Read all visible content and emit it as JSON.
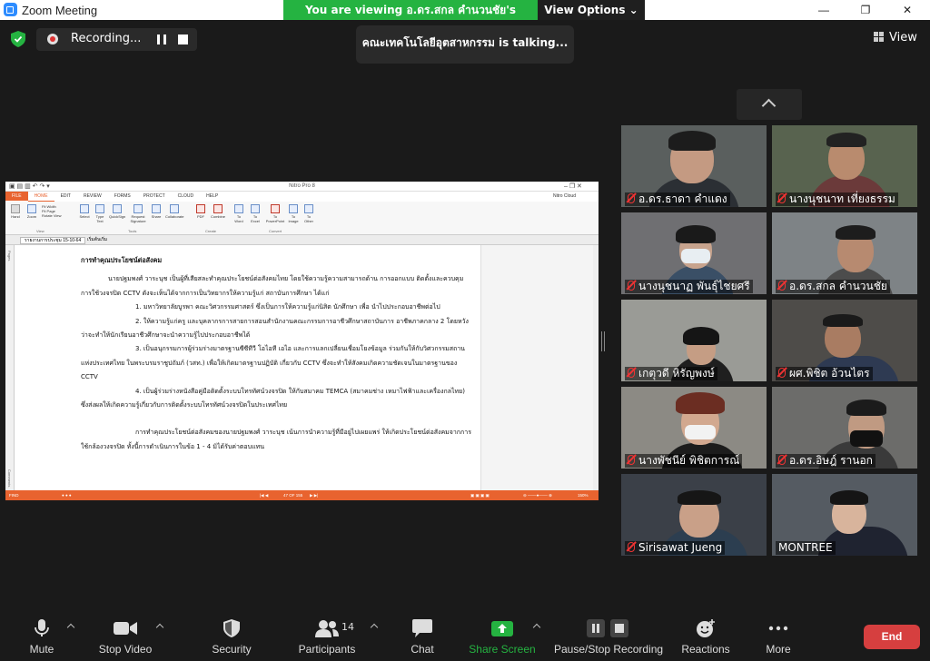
{
  "window": {
    "title": "Zoom Meeting",
    "minimize": "—",
    "maximize": "❐",
    "close": "✕"
  },
  "share_banner": {
    "viewing": "You are viewing อ.ดร.สกล คำนวนชัย's screen",
    "view_options": "View Options ⌄"
  },
  "recording": {
    "label": "Recording..."
  },
  "talking": "คณะเทคโนโลยีอุตสาหกรรม is talking...",
  "view_button": "View",
  "shared_app": {
    "title": "Nitro Pro 8",
    "cloud": "Nitro Cloud",
    "tabs": [
      "FILE",
      "HOME",
      "EDIT",
      "REVIEW",
      "FORMS",
      "PROTECT",
      "CLOUD",
      "HELP"
    ],
    "ribbon_items": [
      "Hand",
      "Zoom",
      "Fit Width",
      "Fit Page",
      "Rotate View",
      "Select",
      "Type Text",
      "QuickSign",
      "Request Signature",
      "Share",
      "Collaborate",
      "PDF",
      "Combine",
      "To Word",
      "To Excel",
      "To PowerPoint",
      "To Image",
      "To Other"
    ],
    "ribbon_groups": [
      "View",
      "Tools",
      "Create",
      "Convert"
    ],
    "doc_tabs": [
      "รายงานการประชุม 15-10-64",
      "เริ่มต้นเริ่ม"
    ],
    "left_panel": [
      "Pages",
      "Comments"
    ],
    "status": {
      "find": "FIND",
      "page": "47 OF 155",
      "zoom": "150%"
    },
    "document": {
      "heading": "การทำคุณประโยชน์ต่อสังคม",
      "paragraphs": [
        "นายปฐมพงศ์ วาระนุช เป็นผู้ที่เสียสละทำคุณประโยชน์ต่อสังคมไทย โดยใช้ความรู้ความสามารถด้าน การออกแบบ ติดตั้งและควบคุมการใช้วงจรปิด CCTV ดังจะเห็นได้จากการเป็นวิทยากรให้ความรู้แก่ สถาบันการศึกษา ได้แก่",
        "1. มหาวิทยาลัยบูรพา คณะวิศวกรรมศาสตร์ ซึ่งเป็นการให้ความรู้แก่นิสิต นักศึกษา เพื่อ นำไปประกอบอาชีพต่อไป",
        "2. ให้ความรู้แก่ครู และบุคลากรการสายการสอนสำนักงานคณะกรรมการอาชีวศึกษาสถาบันการ อาชีพภาคกลาง 2 โดยหวังว่าจะทำให้นักเรียนอาชีวศึกษาจะนำความรู้ไปประกอบอาชีพได้",
        "3. เป็นอนุกรรมการผู้ร่วมร่างมาตรฐานซีซีทีวี โอไอที เอไอ และการแลกเปลี่ยนเชื่อมโยงข้อมูล ร่วมกันให้กับวิศวกรรมสถานแห่งประเทศไทย ในพระบรมราชูปถัมภ์ (วสท.) เพื่อให้เกิดมาตรฐานปฏิบัติ เกี่ยวกับ CCTV ซึ่งจะทำให้สังคมเกิดความชัดเจนในมาตรฐานของ CCTV",
        "4. เป็นผู้ร่วมร่างหนังสือคู่มือติดตั้งระบบโทรทัศน์วงจรปิด ให้กับสมาคม TEMCA (สมาคมช่าง เหมาไฟฟ้าและเครื่องกลไทย) ซึ่งส่งผลให้เกิดความรู้เกี่ยวกับการติดตั้งระบบโทรทัศน์วงจรปิดในประเทศไทย",
        "การทำคุณประโยชน์ต่อสังคมของนายปฐมพงศ์ วาระนุช เน้นการนำความรู้ที่มีอยู่ไปเผยแพร่ ให้เกิดประโยชน์ต่อสังคมจากการใช้กล้องวงจรปิด ทั้งนี้การดำเนินการในข้อ 1 - 4 มิได้รับค่าตอบแทน"
      ]
    }
  },
  "participants_tiles": [
    {
      "name": "อ.ดร.ธาดา คำแดง",
      "muted": true
    },
    {
      "name": "นางนุชนาท เที่ยงธรรม",
      "muted": true
    },
    {
      "name": "นางนุชนาฏ พันธุ์ไชยศรี",
      "muted": true
    },
    {
      "name": "อ.ดร.สกล คำนวนชัย",
      "muted": true
    },
    {
      "name": "เกตุวดี หิรัญพงษ์",
      "muted": true
    },
    {
      "name": "ผศ.พิชิต อ้วนไตร",
      "muted": true
    },
    {
      "name": "นางพัชนีย์ พิชิตการณ์",
      "muted": true
    },
    {
      "name": "อ.ดร.อิษฎ์ รานอก",
      "muted": true
    },
    {
      "name": "Sirisawat Jueng",
      "muted": true
    },
    {
      "name": "MONTREE",
      "muted": false
    }
  ],
  "toolbar": {
    "mute": "Mute",
    "stop_video": "Stop Video",
    "security": "Security",
    "participants": "Participants",
    "participants_count": "14",
    "chat": "Chat",
    "share_screen": "Share Screen",
    "pause_stop_recording": "Pause/Stop Recording",
    "reactions": "Reactions",
    "more": "More",
    "end": "End"
  },
  "colors": {
    "green": "#25b341",
    "end_red": "#d63f3f",
    "nitro_orange": "#e8632f"
  }
}
